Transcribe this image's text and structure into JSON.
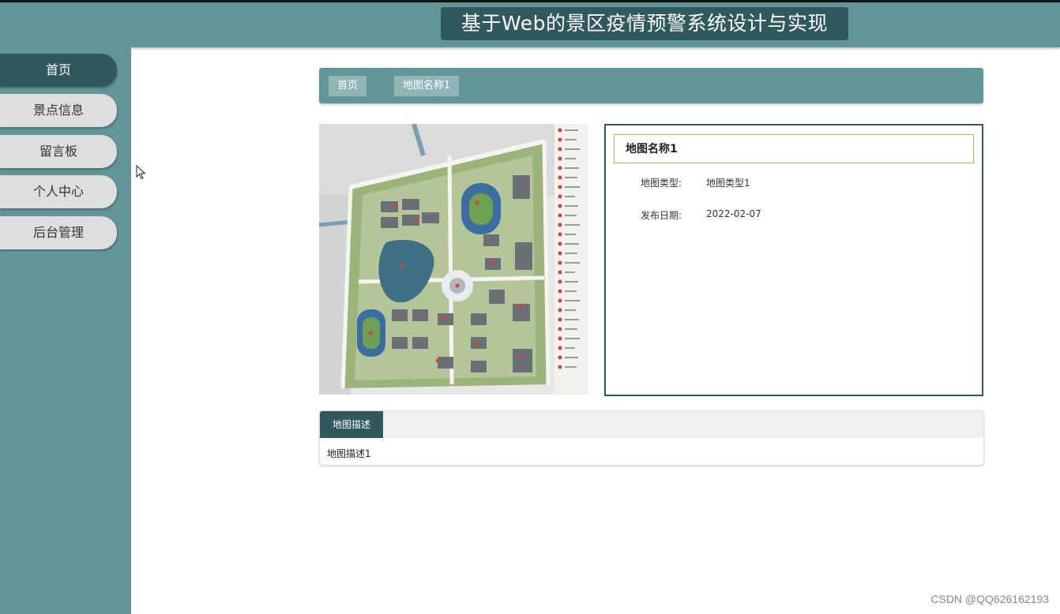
{
  "header": {
    "title": "基于Web的景区疫情预警系统设计与实现"
  },
  "sidebar": {
    "items": [
      {
        "label": "首页"
      },
      {
        "label": "景点信息"
      },
      {
        "label": "留言板"
      },
      {
        "label": "个人中心"
      },
      {
        "label": "后台管理"
      }
    ],
    "active_index": 0
  },
  "breadcrumb": {
    "home": "首页",
    "current": "地图名称1"
  },
  "detail": {
    "name": "地图名称1",
    "fields": [
      {
        "label": "地图类型:",
        "value": "地图类型1"
      },
      {
        "label": "发布日期:",
        "value": "2022-02-07"
      }
    ]
  },
  "description": {
    "tab_label": "地图描述",
    "text": "地图描述1"
  },
  "watermark": "CSDN @QQ626162193",
  "colors": {
    "header": "#629598",
    "accent_dark": "#30595e",
    "name_border": "#d4a548"
  }
}
